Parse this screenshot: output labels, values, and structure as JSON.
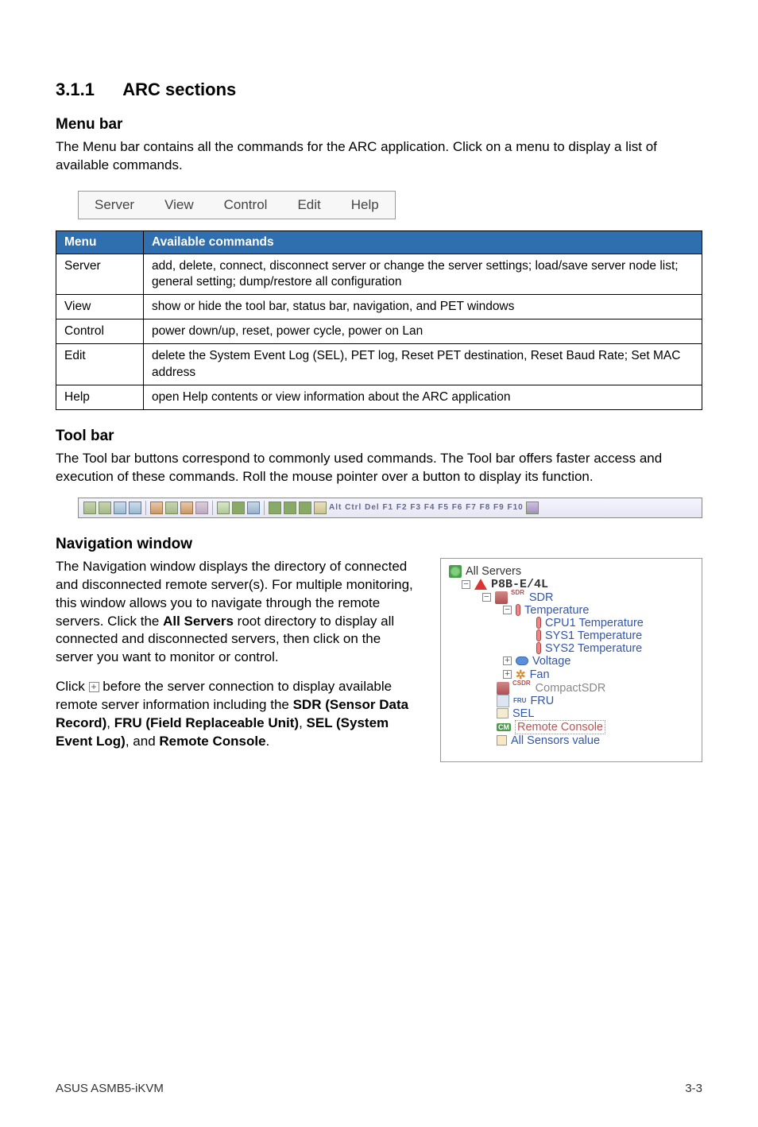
{
  "section": {
    "number": "3.1.1",
    "title": "ARC sections"
  },
  "menubar_section": {
    "heading": "Menu bar",
    "para": "The Menu bar contains all the commands for the ARC application. Click on a menu to display a list of available commands.",
    "items": [
      "Server",
      "View",
      "Control",
      "Edit",
      "Help"
    ]
  },
  "commands_table": {
    "head_menu": "Menu",
    "head_cmds": "Available commands",
    "rows": [
      {
        "menu": "Server",
        "cmds": "add, delete, connect, disconnect server or change the server settings; load/save server node list; general setting; dump/restore all configuration"
      },
      {
        "menu": "View",
        "cmds": "show or hide the tool bar, status bar, navigation, and PET windows"
      },
      {
        "menu": "Control",
        "cmds": "power down/up, reset, power cycle, power on Lan"
      },
      {
        "menu": "Edit",
        "cmds": "delete the System Event Log (SEL), PET log, Reset PET destination, Reset Baud Rate; Set MAC address"
      },
      {
        "menu": "Help",
        "cmds": "open Help contents or view information about the ARC application"
      }
    ]
  },
  "toolbar_section": {
    "heading": "Tool bar",
    "para": "The Tool bar buttons correspond to commonly used commands. The Tool bar offers faster access and execution of these commands. Roll the mouse pointer over a button to display its function.",
    "keys_text": "Alt Ctrl Del  F1  F2  F3  F4  F5  F6  F7  F8  F9  F10"
  },
  "nav_section": {
    "heading": "Navigation window",
    "para1_a": "The Navigation window displays the directory of connected and disconnected remote server(s). For multiple monitoring, this window allows you to navigate through the remote servers. Click the ",
    "para1_bold": "All Servers",
    "para1_b": " root directory to display all connected and disconnected servers, then click on the server you want to monitor or control.",
    "para2_a": "Click ",
    "para2_b": " before the server connection to display available remote server information including the ",
    "para2_bold1": "SDR (Sensor Data Record)",
    "para2_c": ", ",
    "para2_bold2": "FRU (Field Replaceable Unit)",
    "para2_d": ", ",
    "para2_bold3": "SEL (System Event Log)",
    "para2_e": ", and ",
    "para2_bold4": "Remote Console",
    "para2_f": "."
  },
  "tree": {
    "root": "All Servers",
    "server": "P8B-E/4L",
    "sdr": "SDR",
    "sdr_label": "SDR",
    "temperature": "Temperature",
    "cpu1_temp": "CPU1 Temperature",
    "sys1_temp": "SYS1 Temperature",
    "sys2_temp": "SYS2 Temperature",
    "voltage": "Voltage",
    "fan": "Fan",
    "compactsdr": "CompactSDR",
    "compactsdr_label": "CSDR",
    "fru": "FRU",
    "fru_label": "FRU",
    "sel": "SEL",
    "remote_console": "Remote Console",
    "all_sensors": "All Sensors value"
  },
  "footer": {
    "left": "ASUS ASMB5-iKVM",
    "right": "3-3"
  }
}
